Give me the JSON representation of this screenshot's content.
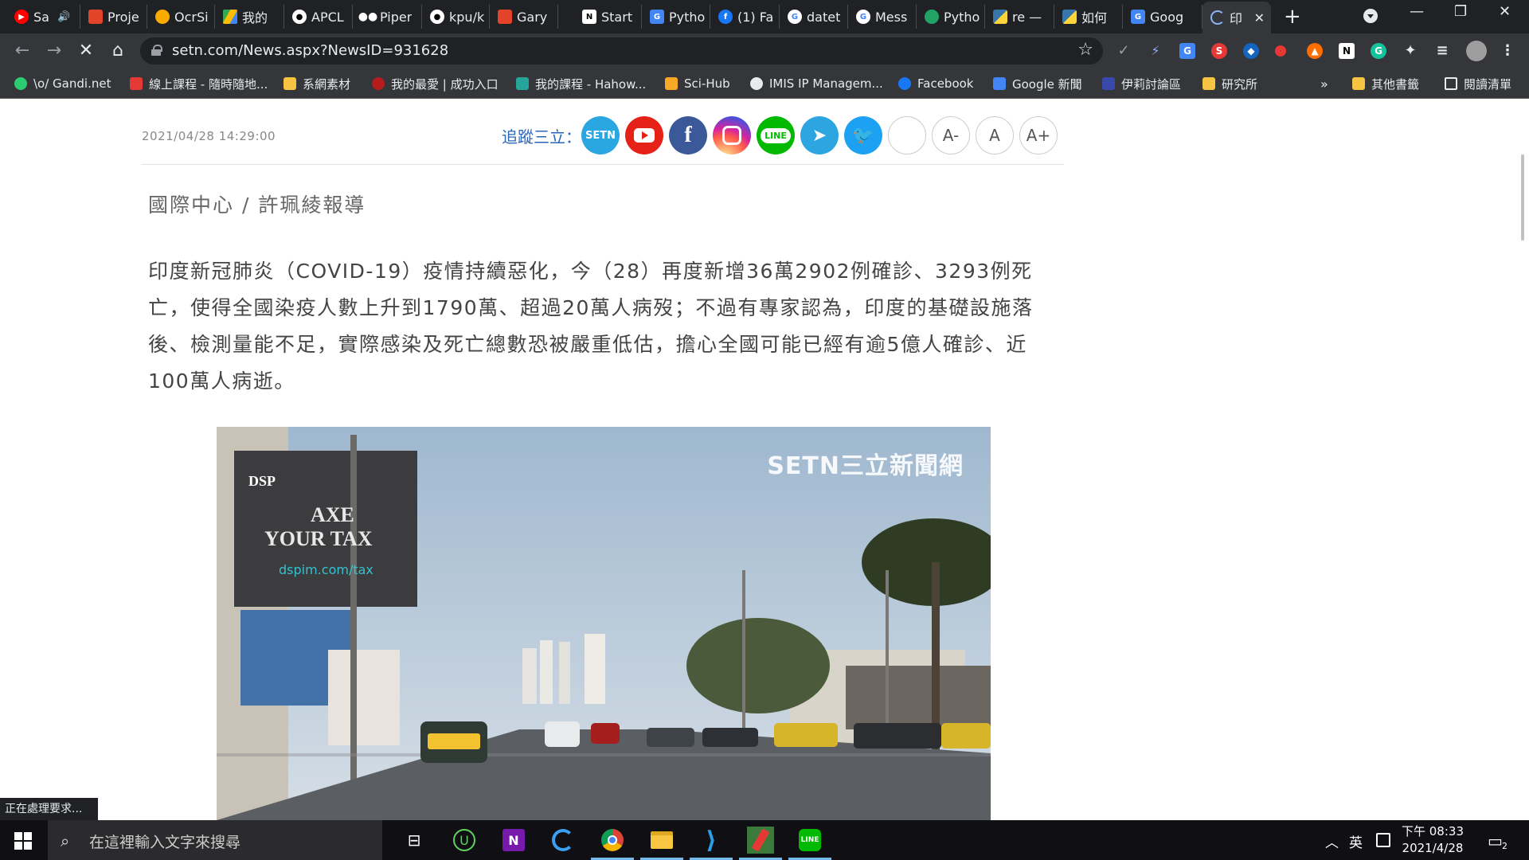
{
  "tabs": [
    {
      "label": "Sa",
      "icon": "youtube-icon"
    },
    {
      "label": "Proje",
      "icon": "gitlab-icon"
    },
    {
      "label": "OcrSi",
      "icon": "colab-icon"
    },
    {
      "label": "我的",
      "icon": "google-drive-icon"
    },
    {
      "label": "APCL",
      "icon": "github-icon"
    },
    {
      "label": "Piper",
      "icon": "piper-icon"
    },
    {
      "label": "kpu/k",
      "icon": "github-icon"
    },
    {
      "label": "Gary",
      "icon": "gitlab-icon"
    },
    {
      "label": "Start",
      "icon": "notion-icon"
    },
    {
      "label": "Pytho",
      "icon": "pycharm-icon"
    },
    {
      "label": "(1) Fa",
      "icon": "facebook-icon"
    },
    {
      "label": "datet",
      "icon": "google-icon"
    },
    {
      "label": "Mess",
      "icon": "google-icon"
    },
    {
      "label": "Pytho",
      "icon": "python-icon"
    },
    {
      "label": "re —",
      "icon": "python-icon"
    },
    {
      "label": "如何",
      "icon": "python-icon"
    },
    {
      "label": "Goog",
      "icon": "google-news-icon"
    },
    {
      "label": "印",
      "icon": "loading-icon"
    }
  ],
  "address": {
    "url": "setn.com/News.aspx?NewsID=931628"
  },
  "bookmarks": [
    {
      "label": "\\o/ Gandi.net",
      "icon": "gandi-icon"
    },
    {
      "label": "線上課程 - 隨時隨地...",
      "icon": "course-icon"
    },
    {
      "label": "系網素材",
      "icon": "folder-icon"
    },
    {
      "label": "我的最愛 | 成功入口",
      "icon": "ncku-icon"
    },
    {
      "label": "我的課程 - Hahow...",
      "icon": "hahow-icon"
    },
    {
      "label": "Sci-Hub",
      "icon": "scihub-icon"
    },
    {
      "label": "IMIS IP Managem...",
      "icon": "globe-icon"
    },
    {
      "label": "Facebook",
      "icon": "facebook-icon"
    },
    {
      "label": "Google 新聞",
      "icon": "google-news-icon"
    },
    {
      "label": "伊莉討論區",
      "icon": "eyny-icon"
    },
    {
      "label": "研究所",
      "icon": "folder-icon"
    }
  ],
  "bookmarks_more": "»",
  "bookmarks_other": "其他書籤",
  "reading_list": "閱讀清單",
  "article": {
    "date": "2021/04/28 14:29:00",
    "follow_label": "追蹤三立：",
    "social": [
      "setn",
      "youtube",
      "facebook",
      "instagram",
      "line",
      "telegram",
      "twitter",
      "blank"
    ],
    "font_buttons": [
      "A-",
      "A",
      "A+"
    ],
    "byline": "國際中心 / 許珮綾報導",
    "paragraph": "印度新冠肺炎（COVID-19）疫情持續惡化，今（28）再度新增36萬2902例確診、3293例死亡，使得全國染疫人數上升到1790萬、超過20萬人病歿；不過有專家認為，印度的基礎設施落後、檢測量能不足，實際感染及死亡總數恐被嚴重低估，擔心全國可能已經有逾5億人確診、近100萬人病逝。",
    "photo_watermark": "SETN三立新聞網",
    "billboard_brand": "DSP",
    "billboard_line1": "AXE",
    "billboard_line2": "YOUR TAX",
    "billboard_url": "dspim.com/tax"
  },
  "status_text": "正在處理要求...",
  "taskbar": {
    "search_placeholder": "在這裡輸入文字來搜尋",
    "ime": "英",
    "clock_period_time": "下午 08:33",
    "clock_date": "2021/4/28",
    "notification_count": "2"
  }
}
